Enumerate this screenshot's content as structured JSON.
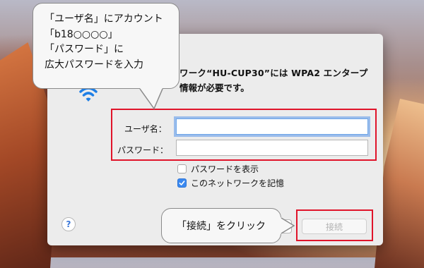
{
  "dialog": {
    "title_line1": "ワーク“HU-CUP30”には WPA2 エンタープ",
    "title_line2": "情報が必要です。",
    "username_label": "ユーザ名：",
    "username_value": "",
    "password_label": "パスワード：",
    "password_value": "",
    "show_password_label": "パスワードを表示",
    "show_password_checked": false,
    "remember_label": "このネットワークを記憶",
    "remember_checked": true,
    "help_label": "?",
    "connect_label": "接続"
  },
  "callouts": {
    "top": [
      "「ユーザ名」にアカウント",
      "「b18○○○○」",
      "「パスワード」に",
      "広大パスワードを入力"
    ],
    "bottom": "「接続」をクリック"
  },
  "icons": {
    "wifi": "wifi-icon",
    "check": "checkmark-icon",
    "help": "help-icon"
  },
  "colors": {
    "highlight": "#e0142a",
    "accent": "#3b89f0",
    "wifi": "#1f7fe5"
  }
}
